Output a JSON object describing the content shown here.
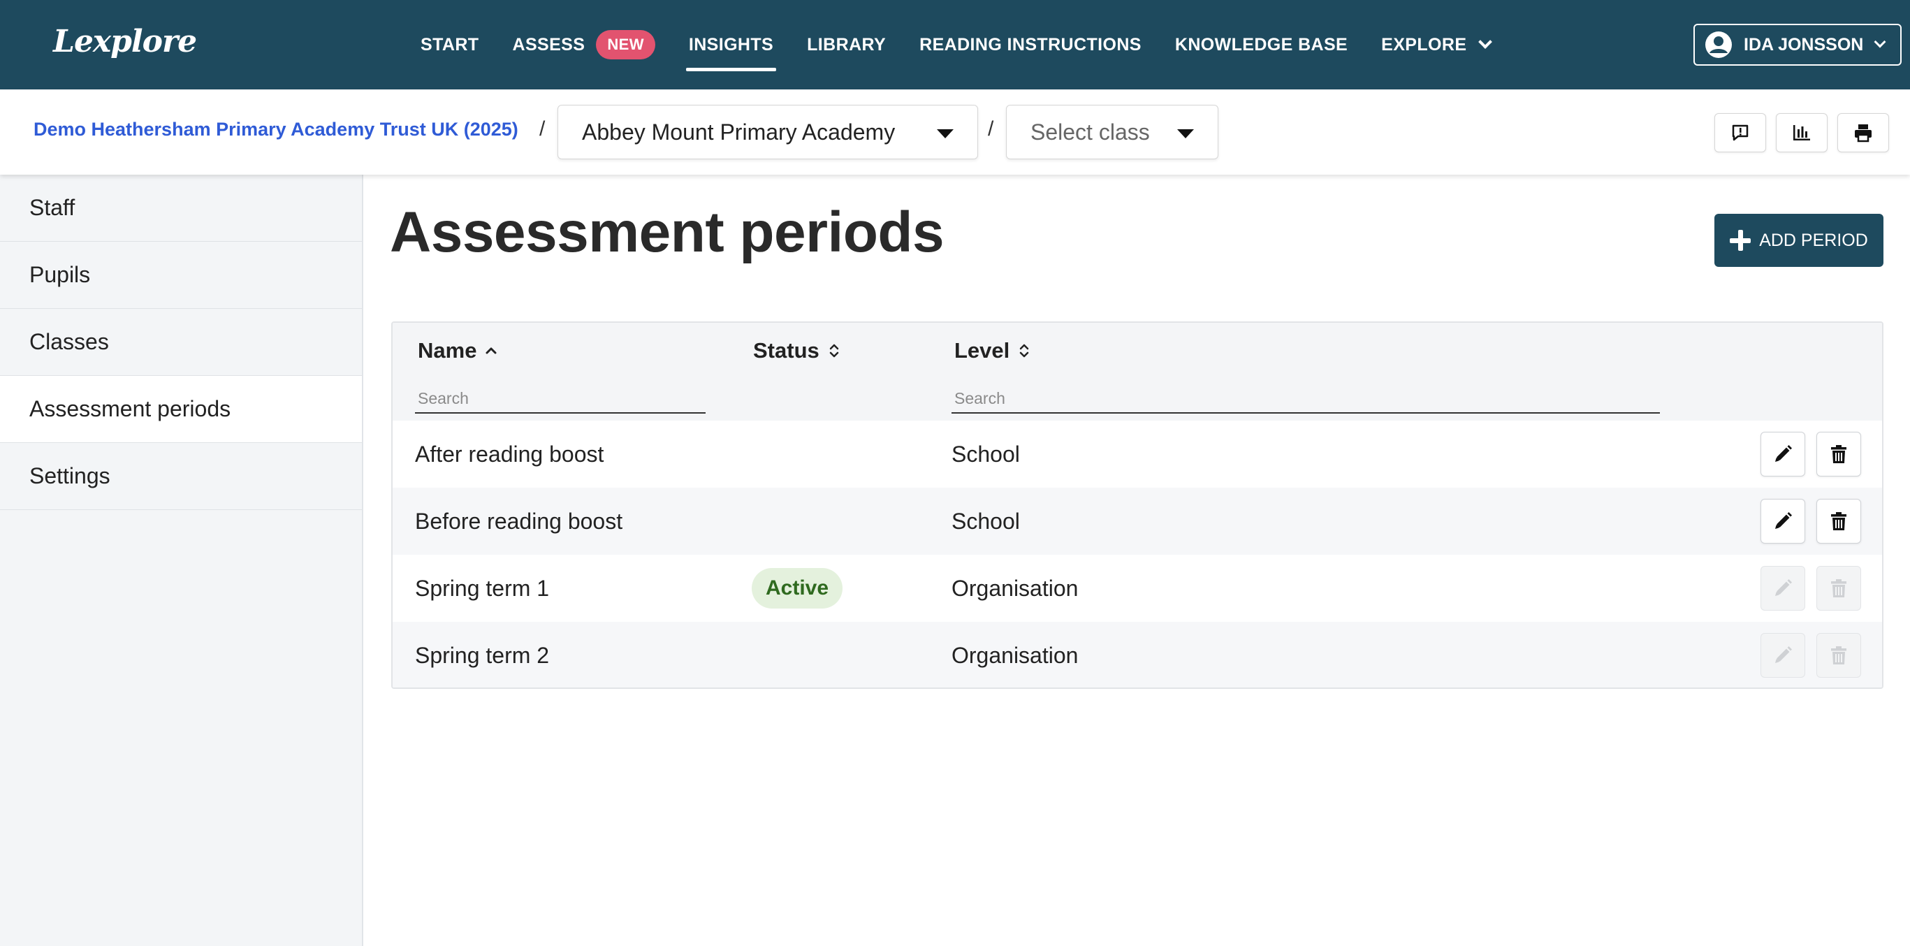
{
  "app": {
    "logo": "Lexplore"
  },
  "nav": {
    "items": [
      {
        "label": "START"
      },
      {
        "label": "ASSESS",
        "badge": "NEW"
      },
      {
        "label": "INSIGHTS",
        "active": true
      },
      {
        "label": "LIBRARY"
      },
      {
        "label": "READING INSTRUCTIONS"
      },
      {
        "label": "KNOWLEDGE BASE"
      },
      {
        "label": "EXPLORE"
      }
    ],
    "user": "IDA JONSSON"
  },
  "breadcrumb": {
    "organisation": "Demo Heathersham Primary Academy Trust UK (2025)",
    "separator": "/",
    "school": "Abbey Mount Primary Academy",
    "class_placeholder": "Select class"
  },
  "sidebar": {
    "items": [
      {
        "label": "Staff"
      },
      {
        "label": "Pupils"
      },
      {
        "label": "Classes"
      },
      {
        "label": "Assessment periods",
        "active": true
      },
      {
        "label": "Settings"
      }
    ]
  },
  "main": {
    "title": "Assessment periods",
    "add_button": "ADD PERIOD",
    "table": {
      "columns": {
        "name": "Name",
        "status": "Status",
        "level": "Level"
      },
      "search_placeholder": "Search",
      "rows": [
        {
          "name": "After reading boost",
          "status": "",
          "level": "School",
          "editable": true
        },
        {
          "name": "Before reading boost",
          "status": "",
          "level": "School",
          "editable": true
        },
        {
          "name": "Spring term 1",
          "status": "Active",
          "level": "Organisation",
          "editable": false
        },
        {
          "name": "Spring term 2",
          "status": "",
          "level": "Organisation",
          "editable": false
        }
      ]
    }
  },
  "colors": {
    "brand": "#1e4a5e",
    "badge": "#e2536f",
    "link": "#2f5bd6",
    "active_badge_bg": "#e4f1dd",
    "active_badge_text": "#2f6a1f"
  }
}
